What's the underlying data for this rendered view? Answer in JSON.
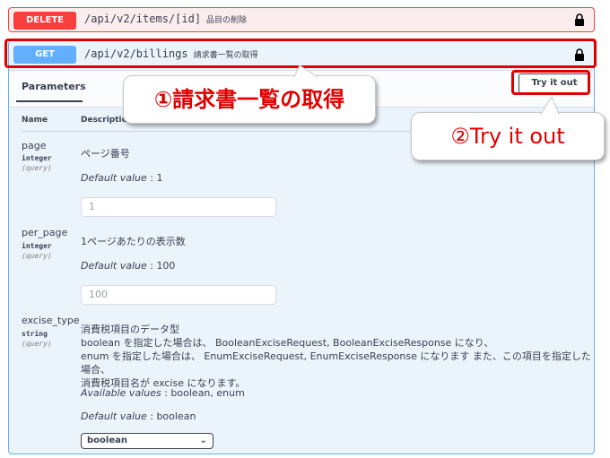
{
  "delete_op": {
    "method": "DELETE",
    "path": "/api/v2/items/[id]",
    "summary": "品目の削除"
  },
  "get_op": {
    "method": "GET",
    "path": "/api/v2/billings",
    "summary": "請求書一覧の取得"
  },
  "params_tab": "Parameters",
  "try_button": "Try it out",
  "columns": {
    "name": "Name",
    "description": "Description"
  },
  "params": [
    {
      "name": "page",
      "type": "integer",
      "in": "(query)",
      "description": "ページ番号",
      "default_label": "Default value",
      "default_value": "1",
      "placeholder": "1"
    },
    {
      "name": "per_page",
      "type": "integer",
      "in": "(query)",
      "description": "1ページあたりの表示数",
      "default_label": "Default value",
      "default_value": "100",
      "placeholder": "100"
    },
    {
      "name": "excise_type",
      "type": "string",
      "in": "(query)",
      "description_lines": [
        "消費税項目のデータ型",
        "boolean を指定した場合は、 BooleanExciseRequest, BooleanExciseResponse になり、",
        "enum を指定した場合は、 EnumExciseRequest, EnumExciseResponse になります また、この項目を指定した場合、",
        "消費税項目名が excise になります。"
      ],
      "available_label": "Available values",
      "available_value": "boolean, enum",
      "default_label": "Default value",
      "default_value": "boolean",
      "select_value": "boolean"
    }
  ],
  "callouts": {
    "one": "①請求書一覧の取得",
    "two": "②Try it out"
  },
  "colors": {
    "delete": "#f93e3e",
    "get": "#61affe",
    "highlight": "#e10000"
  }
}
